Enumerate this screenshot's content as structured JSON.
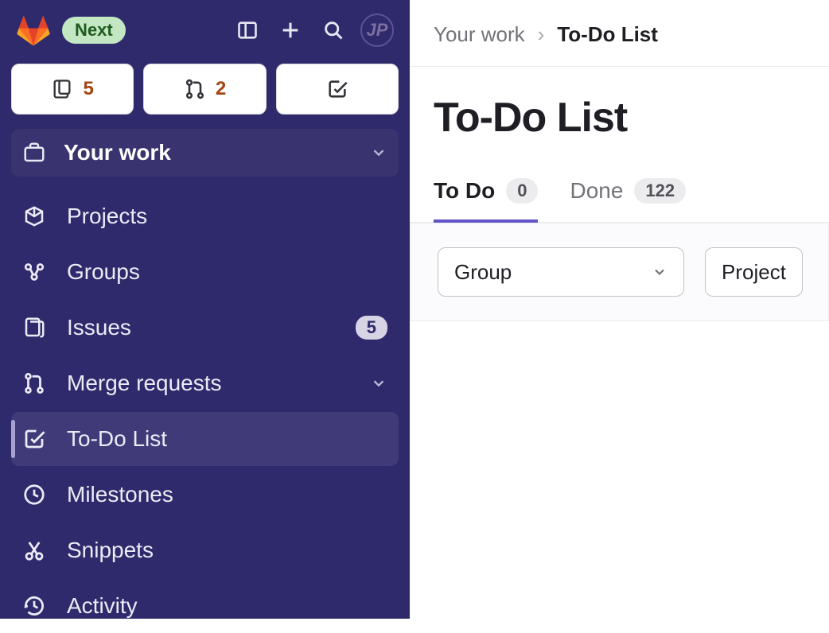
{
  "header": {
    "next_badge": "Next",
    "avatar_initials": "JP"
  },
  "stats": {
    "issues": "5",
    "merge_requests": "2"
  },
  "your_work_label": "Your work",
  "nav": {
    "projects": "Projects",
    "groups": "Groups",
    "issues": "Issues",
    "issues_count": "5",
    "merge_requests": "Merge requests",
    "todo": "To-Do List",
    "milestones": "Milestones",
    "snippets": "Snippets",
    "activity": "Activity"
  },
  "breadcrumb": {
    "parent": "Your work",
    "current": "To-Do List"
  },
  "page_title": "To-Do List",
  "tabs": {
    "todo_label": "To Do",
    "todo_count": "0",
    "done_label": "Done",
    "done_count": "122"
  },
  "filters": {
    "group": "Group",
    "project": "Project"
  }
}
